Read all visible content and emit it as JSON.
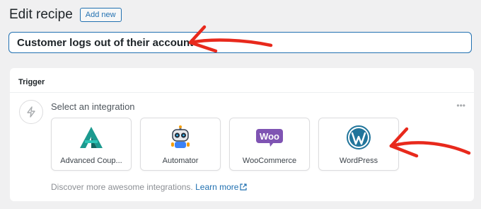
{
  "header": {
    "title": "Edit recipe",
    "add_new_label": "Add new"
  },
  "recipe": {
    "title_value": "Customer logs out of their account"
  },
  "trigger": {
    "label": "Trigger",
    "select_label": "Select an integration",
    "more_icon": "ellipsis-icon",
    "integrations": [
      {
        "name": "Advanced Coup...",
        "icon": "advanced-coupons-logo"
      },
      {
        "name": "Automator",
        "icon": "automator-robot-logo"
      },
      {
        "name": "WooCommerce",
        "icon": "woocommerce-logo",
        "logo_text": "Woo"
      },
      {
        "name": "WordPress",
        "icon": "wordpress-logo"
      }
    ],
    "discover_text": "Discover more awesome integrations.",
    "learn_more_label": "Learn more"
  },
  "colors": {
    "accent": "#2271b1",
    "annotation": "#e8291c",
    "woo_purple": "#7f54b3",
    "advanced_coupons_teal": "#1c9a8f"
  }
}
